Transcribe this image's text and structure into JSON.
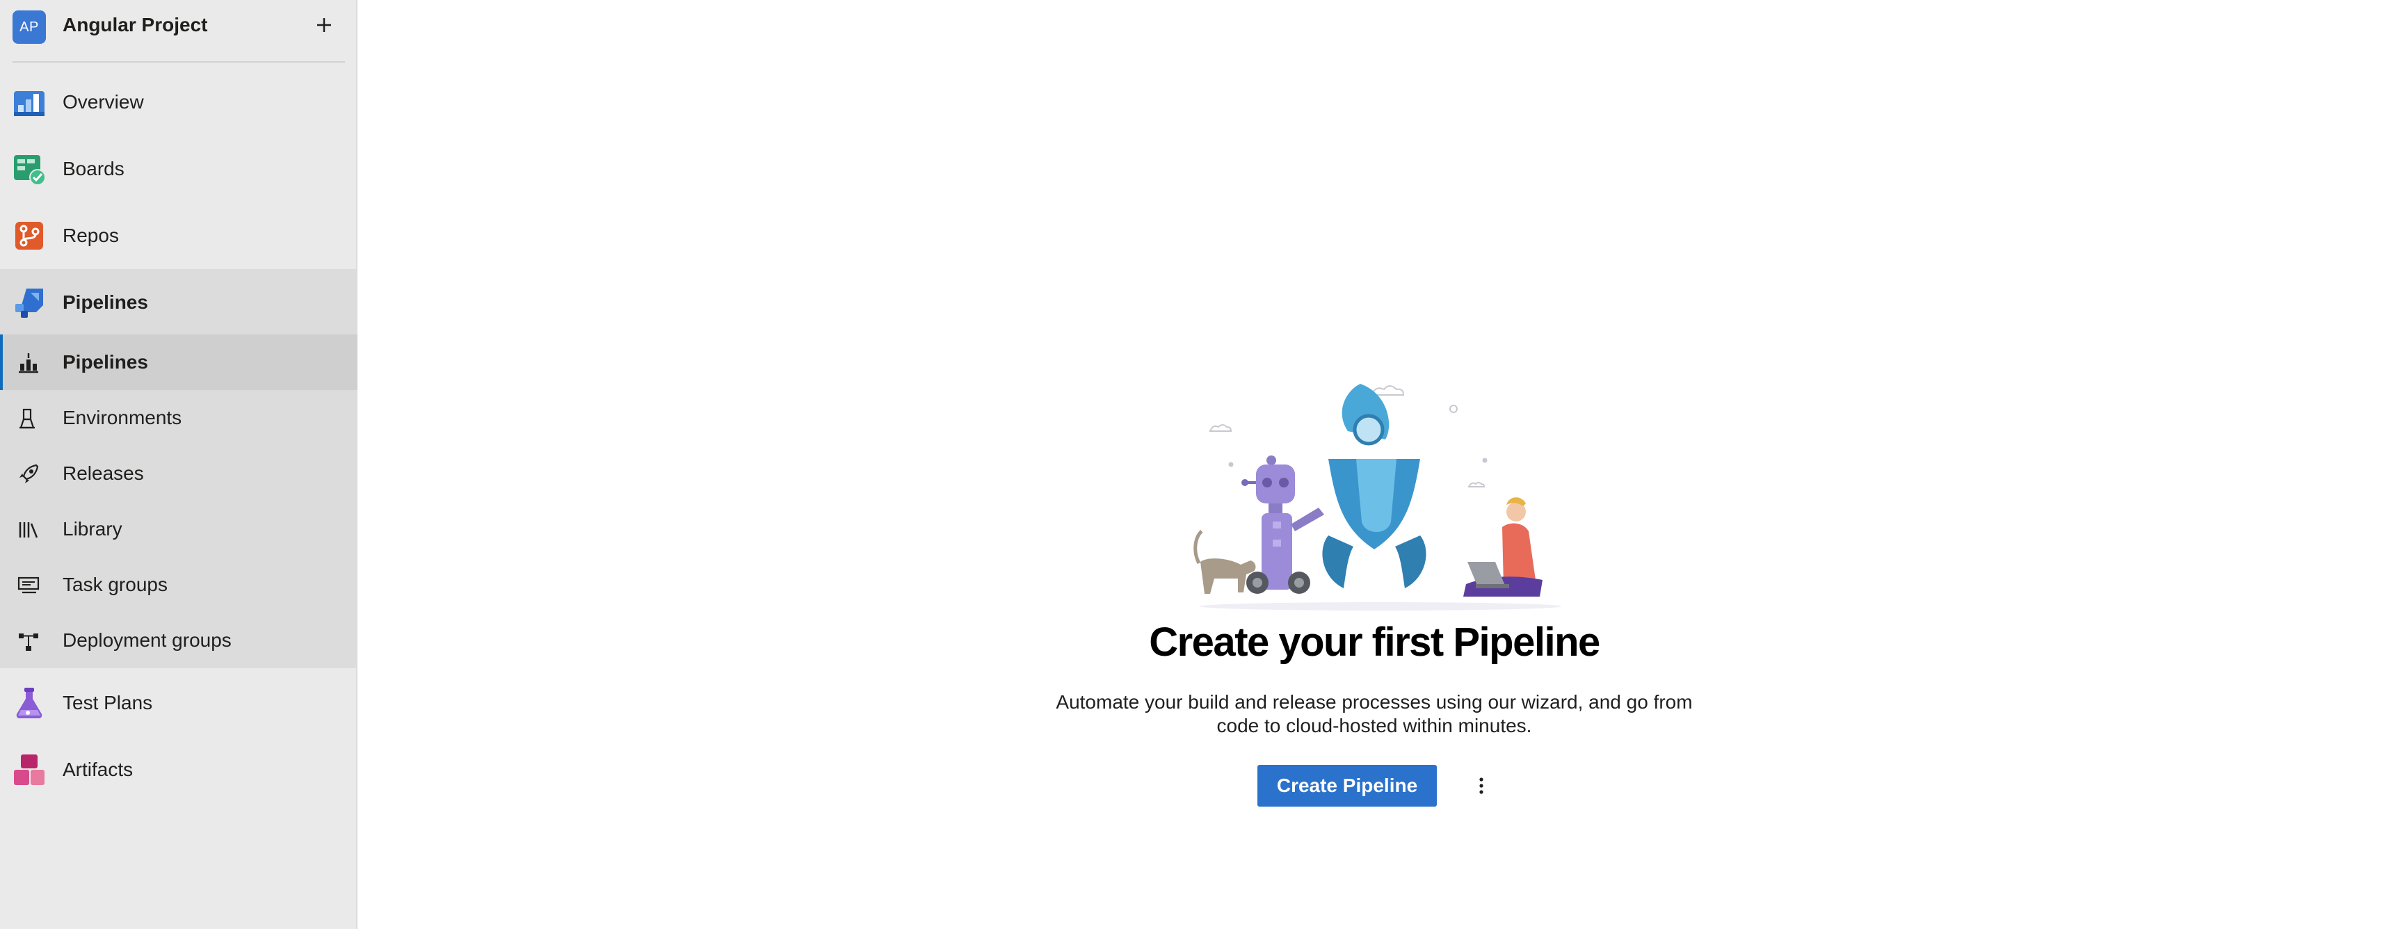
{
  "project": {
    "avatar_initials": "AP",
    "name": "Angular Project",
    "add_icon": "plus-icon",
    "avatar_color": "#3a78d4"
  },
  "nav": {
    "overview": {
      "label": "Overview",
      "icon": "overview-icon"
    },
    "boards": {
      "label": "Boards",
      "icon": "boards-icon"
    },
    "repos": {
      "label": "Repos",
      "icon": "repos-icon"
    },
    "pipelines": {
      "label": "Pipelines",
      "icon": "pipelines-icon"
    },
    "test_plans": {
      "label": "Test Plans",
      "icon": "test-plans-icon"
    },
    "artifacts": {
      "label": "Artifacts",
      "icon": "artifacts-icon"
    }
  },
  "pipelines_sub": {
    "pipelines": {
      "label": "Pipelines",
      "icon": "pipeline-icon"
    },
    "environments": {
      "label": "Environments",
      "icon": "environment-icon"
    },
    "releases": {
      "label": "Releases",
      "icon": "rocket-icon"
    },
    "library": {
      "label": "Library",
      "icon": "library-icon"
    },
    "task_groups": {
      "label": "Task groups",
      "icon": "task-group-icon"
    },
    "deployment_groups": {
      "label": "Deployment groups",
      "icon": "deployment-group-icon"
    }
  },
  "empty_state": {
    "title": "Create your first Pipeline",
    "description_line1": "Automate your build and release processes using our wizard, and go from",
    "description_line2": "code to cloud-hosted within minutes.",
    "create_button": "Create Pipeline",
    "more_icon": "more-vertical-icon"
  },
  "colors": {
    "accent": "#2b72cc",
    "sidebar_bg": "#eaeaea",
    "selected_bg": "#cfcfcf"
  }
}
